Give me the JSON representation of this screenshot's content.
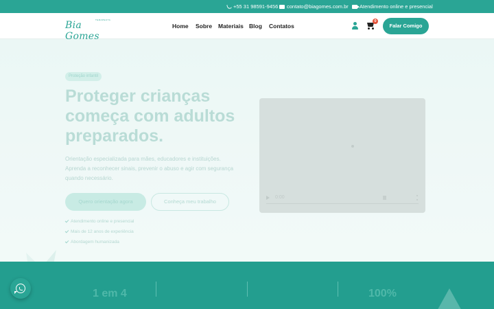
{
  "topbar": {
    "phone": "+55 31 98591-9456",
    "email": "contato@biagomes.com.br",
    "service": "Atendimento online e presencial"
  },
  "header": {
    "logo_text": "Bia Gomes",
    "logo_tagline": "TERAPEUTA",
    "nav": [
      "Home",
      "Sobre",
      "Materiais",
      "Blog",
      "Contatos"
    ],
    "cart_count": "0",
    "cta": "Falar Comigo"
  },
  "hero": {
    "badge": "Proteção infantil",
    "title": "Proteger crianças começa com adultos preparados.",
    "text": "Orientação especializada para mães, educadores e instituições. Aprenda a reconhecer sinais, prevenir o abuso e agir com segurança quando necessário.",
    "primary_button": "Quero orientação agora",
    "secondary_button": "Conheça meu trabalho",
    "checks": [
      "Atendimento online e presencial",
      "Mais de 12 anos de experiência",
      "Abordagem humanizada"
    ]
  },
  "video": {
    "time": "0:00"
  },
  "stats": {
    "left": "1 em 4",
    "right": "100%"
  },
  "colors": {
    "brand": "#2aa595",
    "badge": "#e5533b"
  }
}
